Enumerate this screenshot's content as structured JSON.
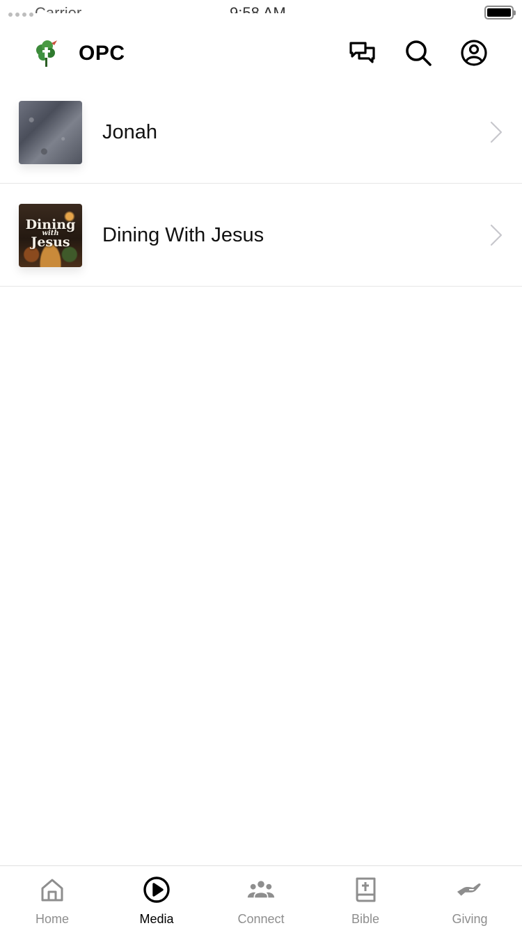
{
  "status_bar": {
    "carrier": "Carrier",
    "time": "9:58 AM",
    "battery_level": 1.0
  },
  "header": {
    "title": "OPC",
    "logo_icon": "tree-cross-logo",
    "actions": [
      {
        "icon": "chat-bubbles-icon"
      },
      {
        "icon": "search-icon"
      },
      {
        "icon": "account-icon"
      }
    ]
  },
  "media_list": [
    {
      "title": "Jonah",
      "thumbnail": "stone-texture"
    },
    {
      "title": "Dining With Jesus",
      "thumbnail": "dining-with-jesus-art",
      "thumbnail_text": {
        "line1": "Dining",
        "line2": "with",
        "line3": "Jesus"
      }
    }
  ],
  "tabbar": {
    "tabs": [
      {
        "label": "Home",
        "icon": "home-icon",
        "active": false
      },
      {
        "label": "Media",
        "icon": "play-circle-icon",
        "active": true
      },
      {
        "label": "Connect",
        "icon": "people-icon",
        "active": false
      },
      {
        "label": "Bible",
        "icon": "bible-icon",
        "active": false
      },
      {
        "label": "Giving",
        "icon": "giving-hand-icon",
        "active": false
      }
    ]
  },
  "colors": {
    "active": "#000000",
    "inactive": "#8e8e8e",
    "divider": "#e6e6e6",
    "chevron": "#c7c7cc"
  }
}
